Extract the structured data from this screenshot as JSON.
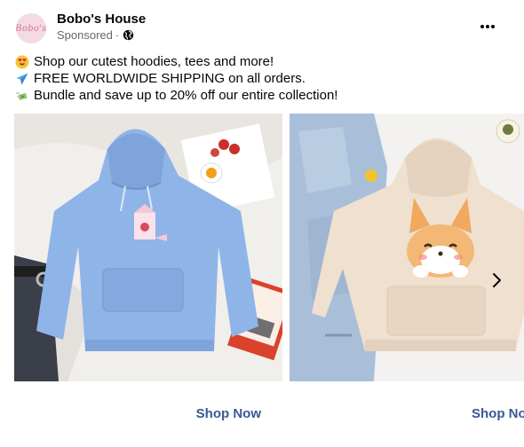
{
  "post": {
    "page_name": "Bobo's House",
    "avatar_text": "Bobo's",
    "sponsored": "Sponsored",
    "separator": "·",
    "more_icon": "more-horizontal-icon"
  },
  "text": {
    "lines": [
      {
        "emoji": "heart-eyes-emoji",
        "text": "Shop our cutest hoodies, tees and more!"
      },
      {
        "emoji": "airplane-emoji",
        "text": "FREE WORLDWIDE SHIPPING on all orders."
      },
      {
        "emoji": "money-with-wings-emoji",
        "text": "Bundle and save up to 20% off our entire collection!"
      }
    ]
  },
  "carousel": {
    "cards": [
      {
        "image": "blue-strawberry-milk-hoodie-photo",
        "cta": "Shop Now"
      },
      {
        "image": "beige-shiba-inu-hoodie-photo",
        "cta": "Shop Now"
      }
    ],
    "next_icon": "chevron-right-icon"
  },
  "colors": {
    "cta": "#385898",
    "secondary_text": "#65676b",
    "blue_hoodie": "#8fb4e8",
    "beige_hoodie": "#efe0cf"
  }
}
